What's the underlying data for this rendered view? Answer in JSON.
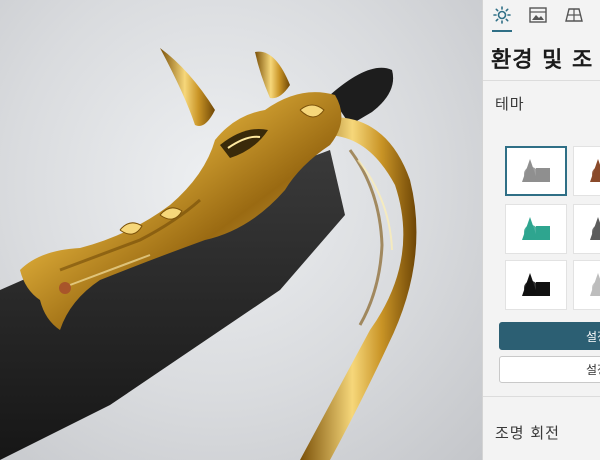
{
  "panel": {
    "tabs": [
      {
        "name": "environment",
        "icon": "sun-icon"
      },
      {
        "name": "background",
        "icon": "image-icon"
      },
      {
        "name": "floor",
        "icon": "floor-grid-icon"
      }
    ],
    "title": "환경 및 조",
    "theme_label": "테마",
    "apply_button_label": "설정",
    "secondary_button_label": "설정",
    "light_rotation_label": "조명 회전",
    "accent_color": "#2f6f86",
    "themes": [
      {
        "id": "gray",
        "color": "#8f8f8f",
        "selected": true
      },
      {
        "id": "copper",
        "color": "#8a4a2a",
        "selected": false
      },
      {
        "id": "teal",
        "color": "#2ea58f",
        "selected": false
      },
      {
        "id": "dark-gray",
        "color": "#5c5c5c",
        "selected": false
      },
      {
        "id": "black",
        "color": "#111111",
        "selected": false
      },
      {
        "id": "light-gray",
        "color": "#bdbdbd",
        "selected": false
      }
    ]
  },
  "viewport": {
    "object": "gold-dragon-scabbard-model"
  }
}
